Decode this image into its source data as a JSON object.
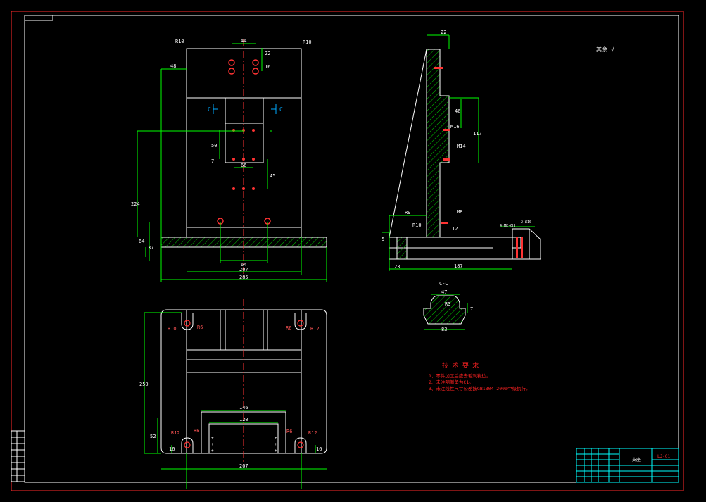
{
  "colors": {
    "background": "#000000",
    "outline": "#ffffff",
    "border": "#ff2a2a",
    "dimension": "#00ff00",
    "centerline": "#ff3333",
    "hatch": "#00cc00",
    "cyan": "#00ffff",
    "section_arrow": "#00aaff",
    "tech_text": "#ff2222",
    "title_block": "#00ffff"
  },
  "front_view": {
    "dimensions": [
      "44",
      "22",
      "16",
      "48",
      "R10",
      "R10",
      "50",
      "7",
      "66",
      "45",
      "224",
      "64",
      "37",
      "64",
      "207",
      "285"
    ],
    "section_marks": [
      "C",
      "C"
    ]
  },
  "top_view": {
    "dimensions": [
      "R10",
      "R6",
      "R6",
      "R12",
      "250",
      "146",
      "120",
      "52",
      "R12",
      "R6",
      "R6",
      "R12",
      "16",
      "16",
      "207"
    ]
  },
  "side_view": {
    "dimensions": [
      "22",
      "46",
      "117",
      "M16",
      "M14",
      "R9",
      "R10",
      "M8",
      "12",
      "5",
      "23",
      "187",
      "4-M8-6H",
      "2-Ø10"
    ]
  },
  "section_view": {
    "title": "C-C",
    "dimensions": [
      "47",
      "R3",
      "7",
      "83"
    ]
  },
  "surface_note": "其余 √",
  "technical_requirements": {
    "title": "技 术 要 求",
    "items": [
      "1、零件加工后应去毛刺锐边。",
      "2、未注明倒角为C1。",
      "3、未注线性尺寸公差按GB1804-2000中级执行。"
    ]
  },
  "title_block": {
    "part_name": "支座",
    "drawing_no": "LJ-01"
  }
}
